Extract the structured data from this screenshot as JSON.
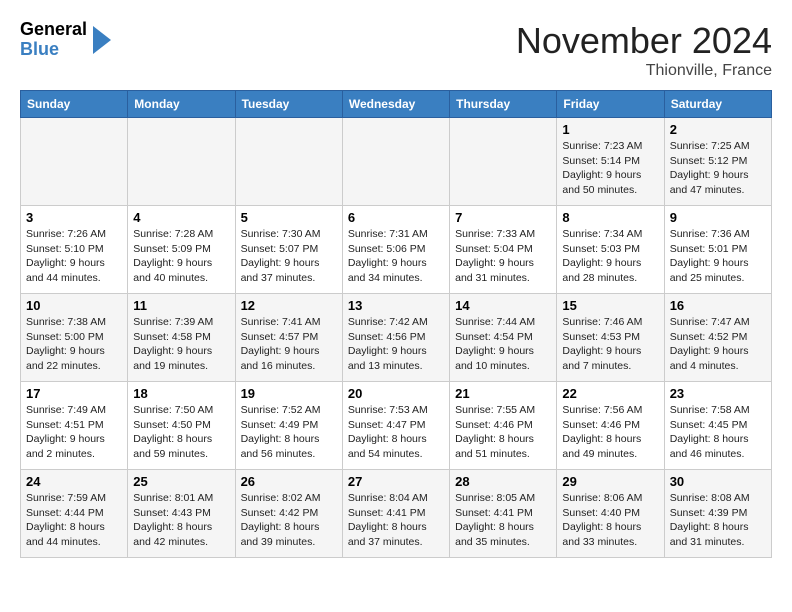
{
  "header": {
    "logo_general": "General",
    "logo_blue": "Blue",
    "month": "November 2024",
    "location": "Thionville, France"
  },
  "weekdays": [
    "Sunday",
    "Monday",
    "Tuesday",
    "Wednesday",
    "Thursday",
    "Friday",
    "Saturday"
  ],
  "weeks": [
    [
      {
        "day": "",
        "info": ""
      },
      {
        "day": "",
        "info": ""
      },
      {
        "day": "",
        "info": ""
      },
      {
        "day": "",
        "info": ""
      },
      {
        "day": "",
        "info": ""
      },
      {
        "day": "1",
        "info": "Sunrise: 7:23 AM\nSunset: 5:14 PM\nDaylight: 9 hours\nand 50 minutes."
      },
      {
        "day": "2",
        "info": "Sunrise: 7:25 AM\nSunset: 5:12 PM\nDaylight: 9 hours\nand 47 minutes."
      }
    ],
    [
      {
        "day": "3",
        "info": "Sunrise: 7:26 AM\nSunset: 5:10 PM\nDaylight: 9 hours\nand 44 minutes."
      },
      {
        "day": "4",
        "info": "Sunrise: 7:28 AM\nSunset: 5:09 PM\nDaylight: 9 hours\nand 40 minutes."
      },
      {
        "day": "5",
        "info": "Sunrise: 7:30 AM\nSunset: 5:07 PM\nDaylight: 9 hours\nand 37 minutes."
      },
      {
        "day": "6",
        "info": "Sunrise: 7:31 AM\nSunset: 5:06 PM\nDaylight: 9 hours\nand 34 minutes."
      },
      {
        "day": "7",
        "info": "Sunrise: 7:33 AM\nSunset: 5:04 PM\nDaylight: 9 hours\nand 31 minutes."
      },
      {
        "day": "8",
        "info": "Sunrise: 7:34 AM\nSunset: 5:03 PM\nDaylight: 9 hours\nand 28 minutes."
      },
      {
        "day": "9",
        "info": "Sunrise: 7:36 AM\nSunset: 5:01 PM\nDaylight: 9 hours\nand 25 minutes."
      }
    ],
    [
      {
        "day": "10",
        "info": "Sunrise: 7:38 AM\nSunset: 5:00 PM\nDaylight: 9 hours\nand 22 minutes."
      },
      {
        "day": "11",
        "info": "Sunrise: 7:39 AM\nSunset: 4:58 PM\nDaylight: 9 hours\nand 19 minutes."
      },
      {
        "day": "12",
        "info": "Sunrise: 7:41 AM\nSunset: 4:57 PM\nDaylight: 9 hours\nand 16 minutes."
      },
      {
        "day": "13",
        "info": "Sunrise: 7:42 AM\nSunset: 4:56 PM\nDaylight: 9 hours\nand 13 minutes."
      },
      {
        "day": "14",
        "info": "Sunrise: 7:44 AM\nSunset: 4:54 PM\nDaylight: 9 hours\nand 10 minutes."
      },
      {
        "day": "15",
        "info": "Sunrise: 7:46 AM\nSunset: 4:53 PM\nDaylight: 9 hours\nand 7 minutes."
      },
      {
        "day": "16",
        "info": "Sunrise: 7:47 AM\nSunset: 4:52 PM\nDaylight: 9 hours\nand 4 minutes."
      }
    ],
    [
      {
        "day": "17",
        "info": "Sunrise: 7:49 AM\nSunset: 4:51 PM\nDaylight: 9 hours\nand 2 minutes."
      },
      {
        "day": "18",
        "info": "Sunrise: 7:50 AM\nSunset: 4:50 PM\nDaylight: 8 hours\nand 59 minutes."
      },
      {
        "day": "19",
        "info": "Sunrise: 7:52 AM\nSunset: 4:49 PM\nDaylight: 8 hours\nand 56 minutes."
      },
      {
        "day": "20",
        "info": "Sunrise: 7:53 AM\nSunset: 4:47 PM\nDaylight: 8 hours\nand 54 minutes."
      },
      {
        "day": "21",
        "info": "Sunrise: 7:55 AM\nSunset: 4:46 PM\nDaylight: 8 hours\nand 51 minutes."
      },
      {
        "day": "22",
        "info": "Sunrise: 7:56 AM\nSunset: 4:46 PM\nDaylight: 8 hours\nand 49 minutes."
      },
      {
        "day": "23",
        "info": "Sunrise: 7:58 AM\nSunset: 4:45 PM\nDaylight: 8 hours\nand 46 minutes."
      }
    ],
    [
      {
        "day": "24",
        "info": "Sunrise: 7:59 AM\nSunset: 4:44 PM\nDaylight: 8 hours\nand 44 minutes."
      },
      {
        "day": "25",
        "info": "Sunrise: 8:01 AM\nSunset: 4:43 PM\nDaylight: 8 hours\nand 42 minutes."
      },
      {
        "day": "26",
        "info": "Sunrise: 8:02 AM\nSunset: 4:42 PM\nDaylight: 8 hours\nand 39 minutes."
      },
      {
        "day": "27",
        "info": "Sunrise: 8:04 AM\nSunset: 4:41 PM\nDaylight: 8 hours\nand 37 minutes."
      },
      {
        "day": "28",
        "info": "Sunrise: 8:05 AM\nSunset: 4:41 PM\nDaylight: 8 hours\nand 35 minutes."
      },
      {
        "day": "29",
        "info": "Sunrise: 8:06 AM\nSunset: 4:40 PM\nDaylight: 8 hours\nand 33 minutes."
      },
      {
        "day": "30",
        "info": "Sunrise: 8:08 AM\nSunset: 4:39 PM\nDaylight: 8 hours\nand 31 minutes."
      }
    ]
  ]
}
